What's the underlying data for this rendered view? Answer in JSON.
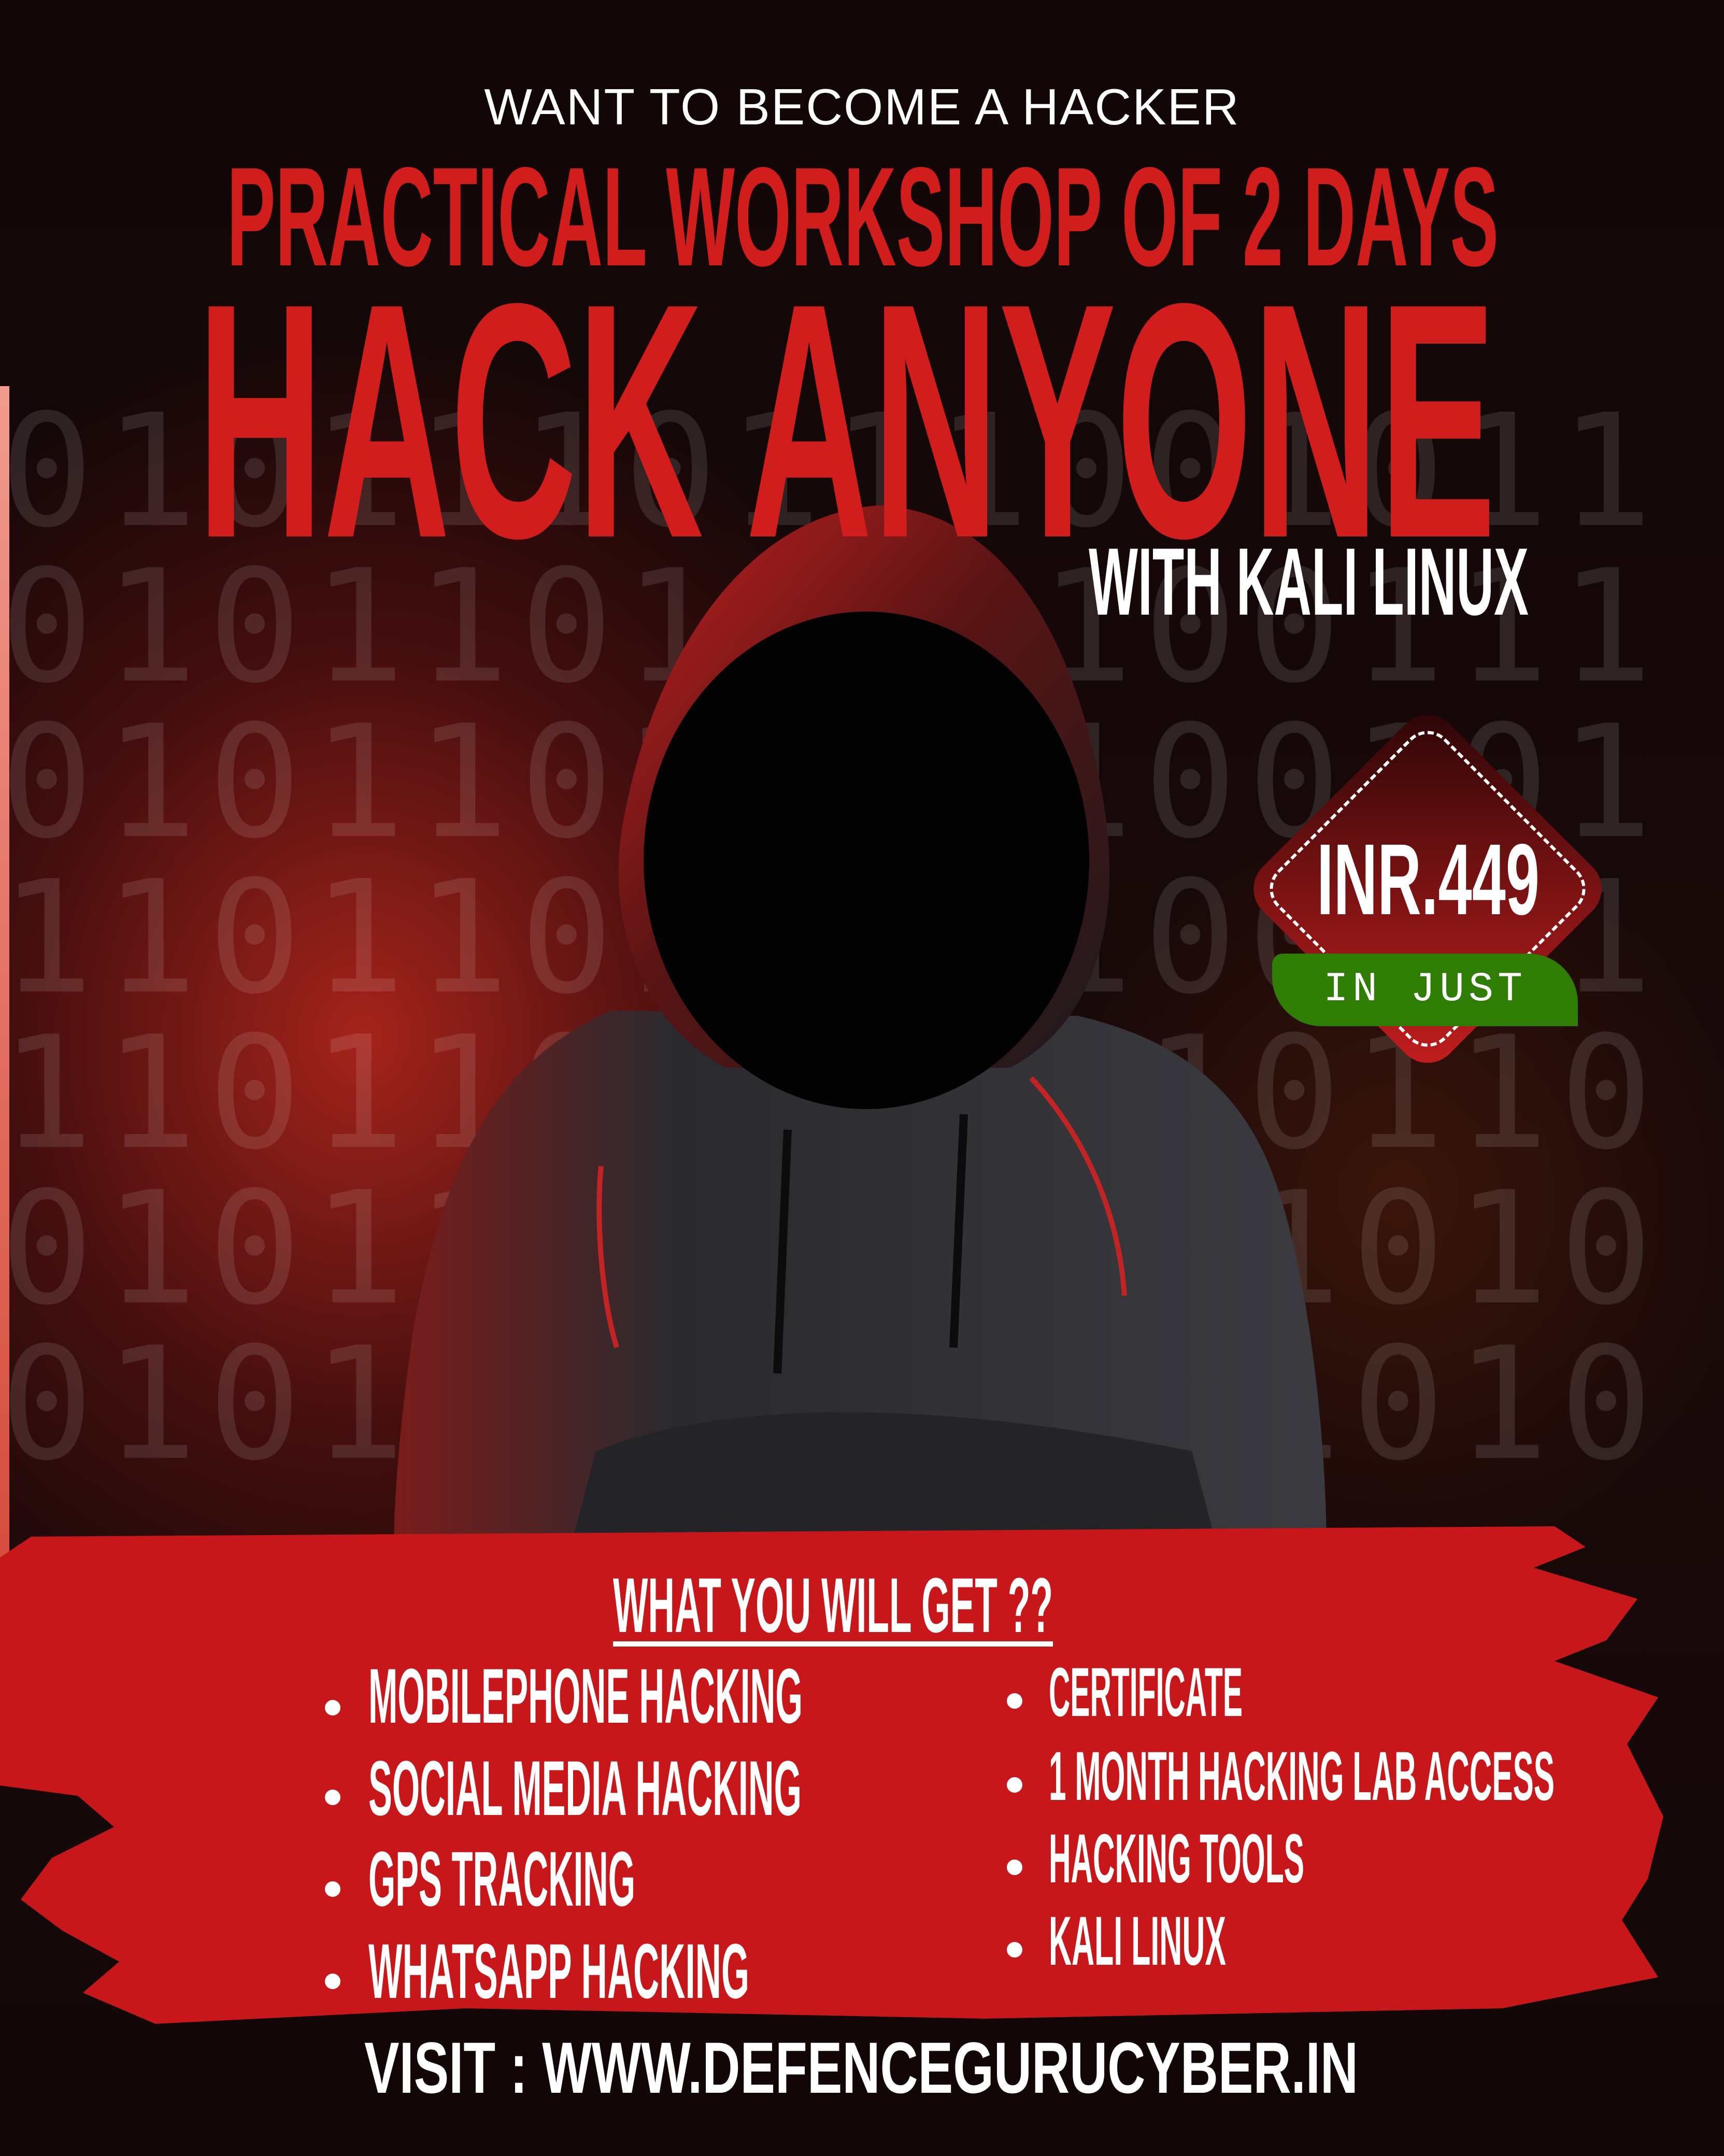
{
  "tagline": "WANT TO BECOME A HACKER",
  "subtitle": "PRACTICAL WORKSHOP OF 2 DAYS",
  "title": "HACK ANYONE",
  "title_suffix": "WITH KALI LINUX",
  "binary_pattern": "0101110111001011010110111010011101011011101001011101101110100101110110010111011001011101101110100101110110111010",
  "price": {
    "amount": "INR.449",
    "label": "IN JUST"
  },
  "benefits": {
    "heading": "WHAT YOU WILL GET  ??",
    "left": [
      "MOBILEPHONE HACKING",
      "SOCIAL MEDIA HACKING",
      "GPS TRACKING",
      "WHATSAPP HACKING"
    ],
    "right": [
      "CERTIFICATE",
      "1 MONTH HACKING LAB ACCESS",
      "HACKING TOOLS",
      "KALI LINUX"
    ]
  },
  "footer": "VISIT : WWW.DEFENCEGURUCYBER.IN",
  "colors": {
    "red": "#d21d1d",
    "green": "#2f7d05",
    "background": "#140809"
  }
}
